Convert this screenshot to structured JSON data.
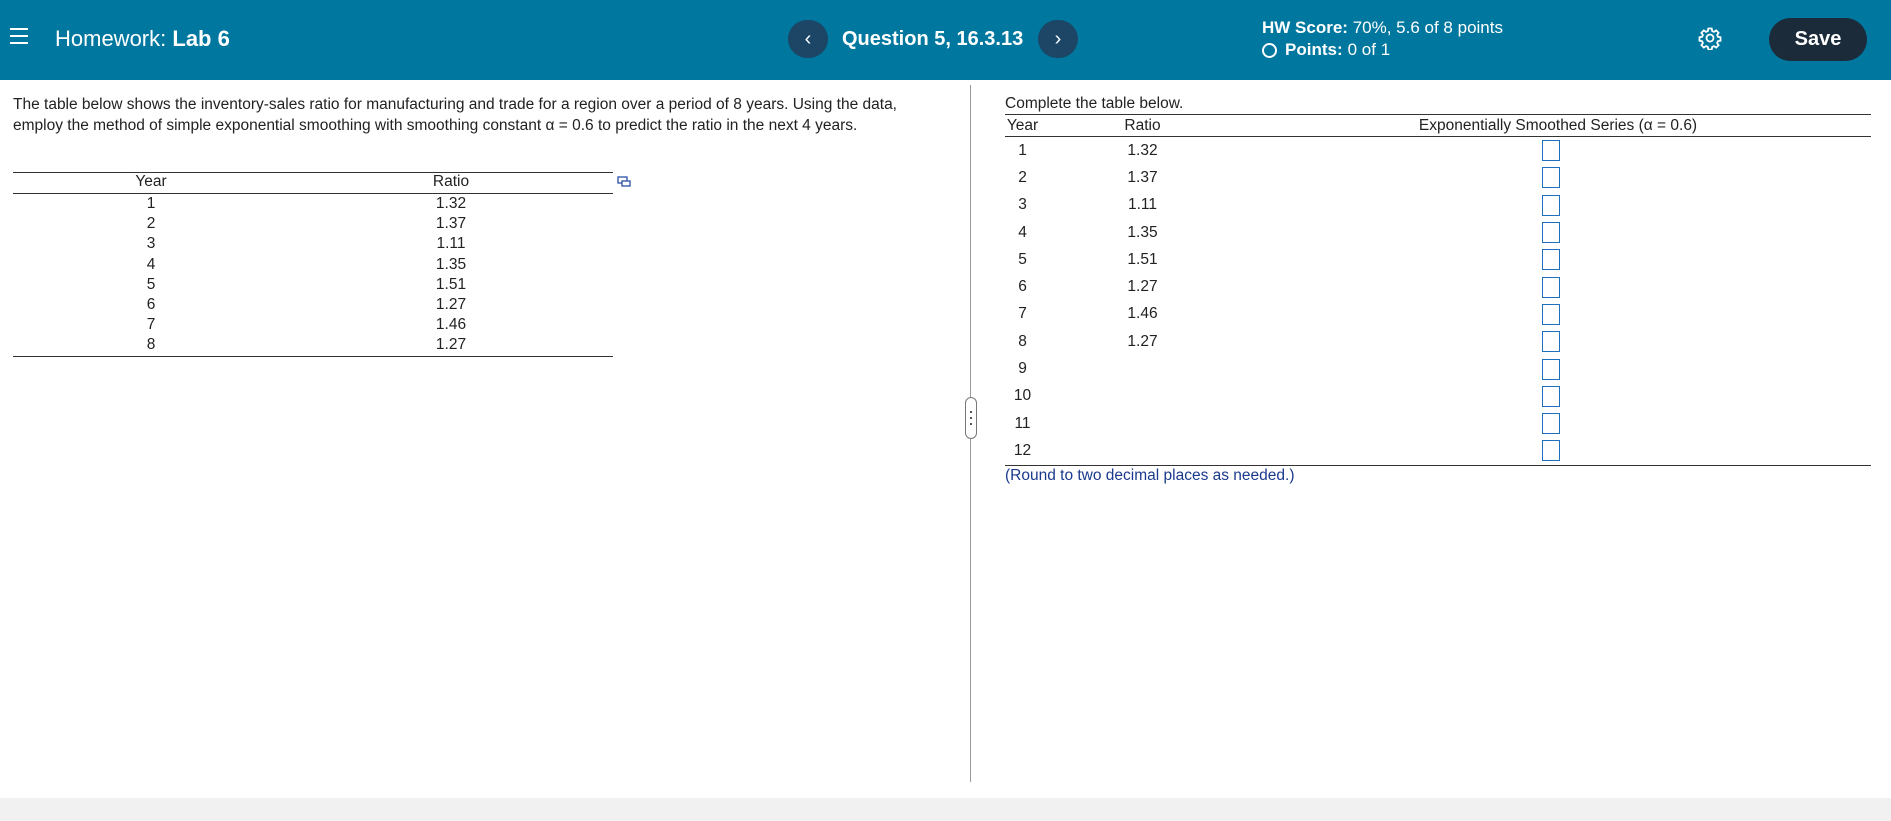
{
  "header": {
    "menu_icon": "hamburger-icon",
    "homework_prefix": "Homework:",
    "homework_name": "Lab 6",
    "question_label": "Question 5, 16.3.13",
    "prev_icon": "chevron-left-icon",
    "next_icon": "chevron-right-icon",
    "hw_score_label": "HW Score:",
    "hw_score_value": "70%, 5.6 of 8 points",
    "points_label": "Points:",
    "points_value": "0 of 1",
    "settings_icon": "gear-icon",
    "save_label": "Save",
    "bar_color": "#00779e",
    "button_color": "#1c4566"
  },
  "problem": {
    "intro_part1": "The table below shows the inventory-sales ratio for manufacturing and trade for a region over a period of 8 years. Using the data, employ the method of simple exponential smoothing with smoothing constant",
    "alpha_expr": "α = 0.6",
    "intro_part2": "to predict the ratio in the next 4 years.",
    "table": {
      "col_year": "Year",
      "col_ratio": "Ratio",
      "rows": [
        {
          "year": "1",
          "ratio": "1.32"
        },
        {
          "year": "2",
          "ratio": "1.37"
        },
        {
          "year": "3",
          "ratio": "1.11"
        },
        {
          "year": "4",
          "ratio": "1.35"
        },
        {
          "year": "5",
          "ratio": "1.51"
        },
        {
          "year": "6",
          "ratio": "1.27"
        },
        {
          "year": "7",
          "ratio": "1.46"
        },
        {
          "year": "8",
          "ratio": "1.27"
        }
      ]
    }
  },
  "answer": {
    "instruction": "Complete the table below.",
    "col_year": "Year",
    "col_ratio": "Ratio",
    "col_series": "Exponentially Smoothed Series (α = 0.6)",
    "rows": [
      {
        "year": "1",
        "ratio": "1.32",
        "value": ""
      },
      {
        "year": "2",
        "ratio": "1.37",
        "value": ""
      },
      {
        "year": "3",
        "ratio": "1.11",
        "value": ""
      },
      {
        "year": "4",
        "ratio": "1.35",
        "value": ""
      },
      {
        "year": "5",
        "ratio": "1.51",
        "value": ""
      },
      {
        "year": "6",
        "ratio": "1.27",
        "value": ""
      },
      {
        "year": "7",
        "ratio": "1.46",
        "value": ""
      },
      {
        "year": "8",
        "ratio": "1.27",
        "value": ""
      },
      {
        "year": "9",
        "ratio": "",
        "value": ""
      },
      {
        "year": "10",
        "ratio": "",
        "value": ""
      },
      {
        "year": "11",
        "ratio": "",
        "value": ""
      },
      {
        "year": "12",
        "ratio": "",
        "value": ""
      }
    ],
    "round_note": "(Round to two decimal places as needed.)"
  }
}
